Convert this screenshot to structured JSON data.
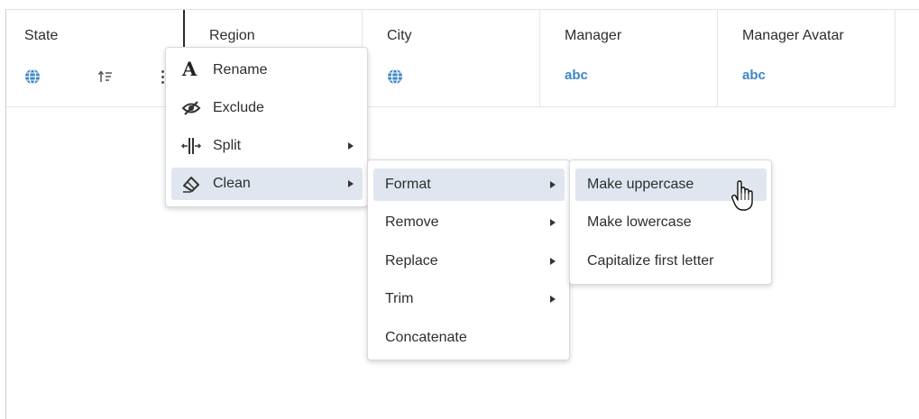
{
  "columns": [
    {
      "title": "State",
      "type_icon": "globe-icon",
      "extra_icons": [
        "sort-icon",
        "more-vertical-icon"
      ]
    },
    {
      "title": "Region"
    },
    {
      "title": "City",
      "type_icon": "globe-icon"
    },
    {
      "title": "Manager",
      "type_label": "abc"
    },
    {
      "title": "Manager Avatar",
      "type_label": "abc"
    }
  ],
  "column_menu": {
    "items": [
      {
        "label": "Rename",
        "icon": "rename-icon"
      },
      {
        "label": "Exclude",
        "icon": "eye-slash-icon"
      },
      {
        "label": "Split",
        "icon": "split-icon",
        "has_submenu": true
      },
      {
        "label": "Clean",
        "icon": "eraser-icon",
        "has_submenu": true,
        "active": true
      }
    ]
  },
  "clean_menu": {
    "items": [
      {
        "label": "Format",
        "has_submenu": true,
        "active": true
      },
      {
        "label": "Remove",
        "has_submenu": true
      },
      {
        "label": "Replace",
        "has_submenu": true
      },
      {
        "label": "Trim",
        "has_submenu": true
      },
      {
        "label": "Concatenate",
        "has_submenu": false
      }
    ]
  },
  "format_menu": {
    "items": [
      {
        "label": "Make uppercase",
        "active": true
      },
      {
        "label": "Make lowercase"
      },
      {
        "label": "Capitalize first letter"
      }
    ]
  },
  "colors": {
    "accent_blue": "#3f86c6",
    "hover_bg": "#dfe6ef",
    "border": "#d6d9de"
  }
}
